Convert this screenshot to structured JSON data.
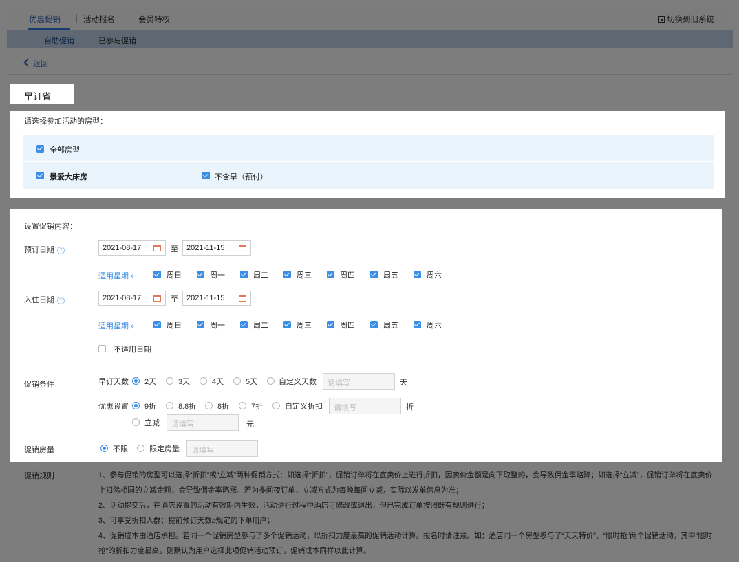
{
  "nav": {
    "tabs": [
      {
        "label": "优惠促销",
        "active": true
      },
      {
        "label": "活动报名",
        "active": false
      },
      {
        "label": "会员特权",
        "active": false
      }
    ],
    "switch_label": "切换到旧系统"
  },
  "subnav": {
    "tabs": [
      {
        "label": "自助促销",
        "active": true
      },
      {
        "label": "已参与促销",
        "active": false
      }
    ]
  },
  "back_label": "返回",
  "promo_title": "早订省",
  "rooms": {
    "section_label": "请选择参加活动的房型：",
    "all_label": "全部房型",
    "all_checked": true,
    "room_name": "景爱大床房",
    "room_checked": true,
    "rate_plan": "不含早（预付）",
    "rate_checked": true
  },
  "settings": {
    "section_label": "设置促销内容：",
    "booking_date": {
      "label": "预订日期",
      "start": "2021-08-17",
      "to": "至",
      "end": "2021-11-15",
      "week_title": "适用星期",
      "days": [
        "周日",
        "周一",
        "周二",
        "周三",
        "周四",
        "周五",
        "周六"
      ]
    },
    "checkin_date": {
      "label": "入住日期",
      "start": "2021-08-17",
      "to": "至",
      "end": "2021-11-15",
      "week_title": "适用星期",
      "days": [
        "周日",
        "周一",
        "周二",
        "周三",
        "周四",
        "周五",
        "周六"
      ]
    },
    "exclude_dates_label": "不适用日期",
    "exclude_dates_checked": false,
    "condition": {
      "label": "促销条件",
      "early_label": "早订天数",
      "options": [
        "2天",
        "3天",
        "4天",
        "5天",
        "自定义天数"
      ],
      "selected": "2天",
      "placeholder": "请填写",
      "unit": "天"
    },
    "discount": {
      "label": "优惠设置",
      "options": [
        "9折",
        "8.8折",
        "8折",
        "7折",
        "自定义折扣"
      ],
      "selected": "9折",
      "placeholder": "请填写",
      "unit": "折",
      "reduce_label": "立减",
      "reduce_placeholder": "请填写",
      "reduce_unit": "元"
    },
    "inventory": {
      "label": "促销房量",
      "options": [
        "不限",
        "限定房量"
      ],
      "selected": "不限",
      "placeholder": "请填写"
    }
  },
  "rules": {
    "label": "促销规则",
    "lines": [
      "1、参与促销的房型可以选择“折扣”或“立减”两种促销方式：如选择“折扣”，促销订单将在底卖价上进行折扣，因卖价金额是向下取整的，会导致佣金率略降；如选择“立减”，促销订单将在底卖价",
      "上扣除相同的立减金额，会导致佣金率略涨。若为多间夜订单，立减方式为每晚每间立减，实际以发单信息为准；",
      "2、活动提交后，在酒店设置的活动有效期内生效，活动进行过程中酒店可修改或退出，但已完成订单按照既有规则进行；",
      "3、可享受折扣人群：提前预订天数≥规定的下单用户；",
      "4、促销成本由酒店承担。若同一个促销房型参与了多个促销活动，以折扣力度最高的促销活动计算。报名时请注意。如：酒店同一个房型参与了“天天特价”、“限时抢”两个促销活动，其中“限时",
      "抢”的折扣力度最高，则默认为用户选择此项促销活动预订，促销成本同样以此计算。"
    ]
  }
}
